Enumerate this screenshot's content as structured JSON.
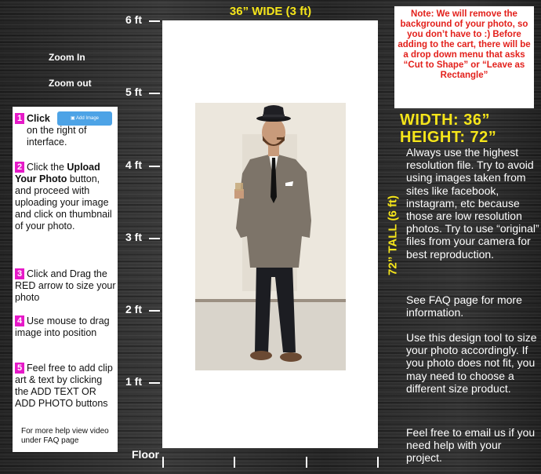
{
  "ruler": {
    "ft_labels": [
      "6 ft",
      "5 ft",
      "4 ft",
      "3 ft",
      "2 ft",
      "1 ft"
    ],
    "floor_label": "Floor"
  },
  "canvas": {
    "width_label": "36” WIDE (3 ft)",
    "height_label": "72” TALL (6 ft)"
  },
  "zoom": {
    "zoom_in": "Zoom In",
    "zoom_out": "Zoom out"
  },
  "instructions": {
    "steps": [
      {
        "num": "1",
        "text_a": "Click",
        "text_b": "on the right of interface."
      },
      {
        "num": "2",
        "text_a": "Click the ",
        "bold": "Upload Your Photo",
        "text_b": " button, and proceed with uploading your image and click on thumbnail of your photo."
      },
      {
        "num": "3",
        "text": "Click and Drag the RED arrow to size your photo"
      },
      {
        "num": "4",
        "text": "Use mouse to drag image into position"
      },
      {
        "num": "5",
        "text": "Feel free to add clip art & text by clicking the ADD TEXT OR ADD PHOTO buttons"
      }
    ],
    "add_image_button": "Add Image",
    "help_note": "For more help view video under FAQ page"
  },
  "note": {
    "text": "Note: We will remove the background of your photo, so you don’t have to :) Before adding to the cart, there will be a drop down menu that asks “Cut to Shape” or “Leave as Rectangle”"
  },
  "dimensions": {
    "width": "WIDTH: 36”",
    "height": "HEIGHT: 72”"
  },
  "info": {
    "p1": "Always use the highest resolution file. Try to avoid using images taken from sites like facebook, instagram, etc because those are low resolution photos. Try to use “original” files from your camera for best reproduction.",
    "p2": "See FAQ page for more information.",
    "p3": "Use this design tool to size your photo accordingly.  If you photo does not fit, you may need to choose a different size product.",
    "p4": "Feel free to email us if you need help with your project."
  },
  "colors": {
    "accent_yellow": "#f5e51a",
    "note_red": "#e3201b",
    "step_magenta": "#e619c8",
    "button_blue": "#4da3e6"
  }
}
